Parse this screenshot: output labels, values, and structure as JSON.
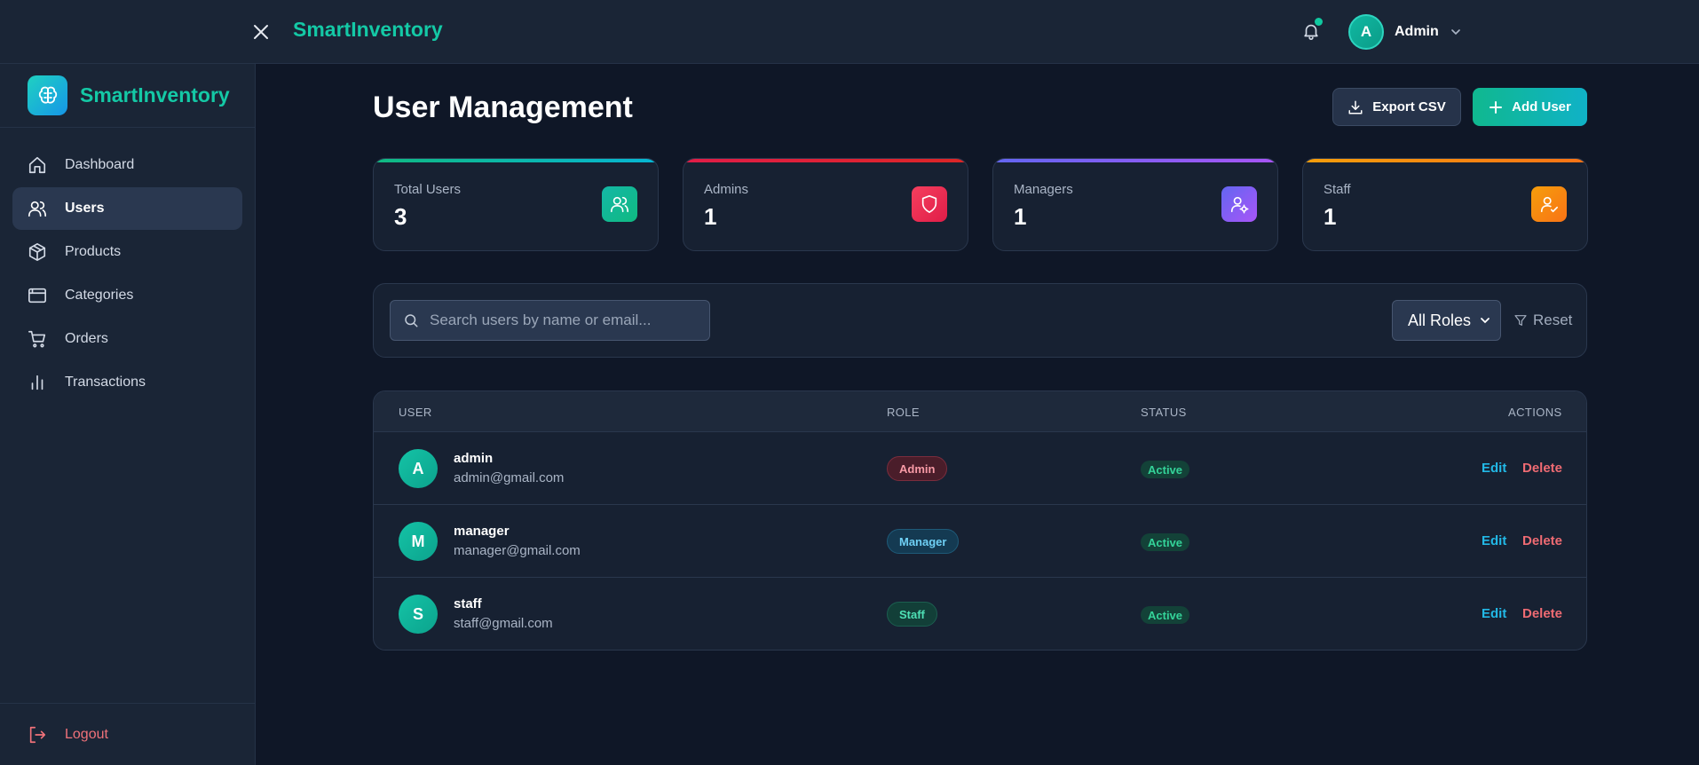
{
  "header": {
    "brand": "SmartInventory",
    "profile_initial": "A",
    "profile_name": "Admin"
  },
  "sidebar": {
    "brand": "SmartInventory",
    "items": [
      {
        "label": "Dashboard",
        "icon": "home-icon",
        "active": false
      },
      {
        "label": "Users",
        "icon": "users-icon",
        "active": true
      },
      {
        "label": "Products",
        "icon": "box-icon",
        "active": false
      },
      {
        "label": "Categories",
        "icon": "folder-icon",
        "active": false
      },
      {
        "label": "Orders",
        "icon": "cart-icon",
        "active": false
      },
      {
        "label": "Transactions",
        "icon": "bar-chart-icon",
        "active": false
      }
    ],
    "logout": "Logout"
  },
  "main": {
    "title": "User Management",
    "export_label": "Export CSV",
    "add_label": "Add User",
    "stats": [
      {
        "label": "Total Users",
        "value": "3",
        "bar": "#14c9a6",
        "icon_bg": "#14b8a6",
        "icon": "users-icon"
      },
      {
        "label": "Admins",
        "value": "1",
        "bar": "#e11d48",
        "icon_bg": "#f43f5e",
        "icon": "shield-icon"
      },
      {
        "label": "Managers",
        "value": "1",
        "bar": "#8b5cf6",
        "icon_bg": "#8b5cf6",
        "icon": "user-cog-icon"
      },
      {
        "label": "Staff",
        "value": "1",
        "bar": "#f59e0b",
        "icon_bg": "#f97316",
        "icon": "user-check-icon"
      }
    ],
    "search_placeholder": "Search users by name or email...",
    "role_filter": "All Roles",
    "reset_label": "Reset",
    "table": {
      "columns": [
        "USER",
        "ROLE",
        "STATUS",
        "ACTIONS"
      ],
      "rows": [
        {
          "initial": "A",
          "name": "admin",
          "email": "admin@gmail.com",
          "role": "Admin",
          "status": "Active"
        },
        {
          "initial": "M",
          "name": "manager",
          "email": "manager@gmail.com",
          "role": "Manager",
          "status": "Active"
        },
        {
          "initial": "S",
          "name": "staff",
          "email": "staff@gmail.com",
          "role": "Staff",
          "status": "Active"
        }
      ],
      "edit_label": "Edit",
      "delete_label": "Delete"
    }
  },
  "colors": {
    "accent": "#14c9a6",
    "background": "#0f1727",
    "panel": "#1a2536",
    "danger": "#ef6b73",
    "link": "#22b8e6"
  }
}
